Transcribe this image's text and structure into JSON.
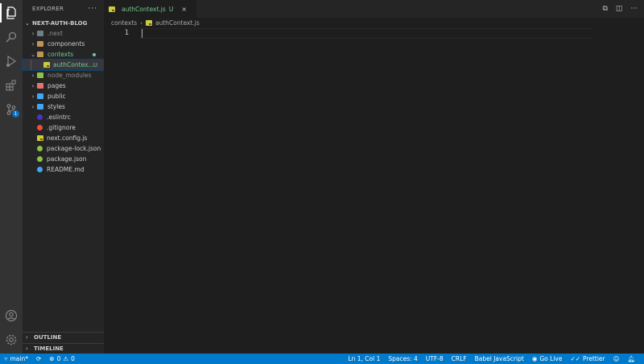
{
  "explorer": {
    "title": "EXPLORER",
    "more": "···",
    "project": "NEXT-AUTH-BLOG",
    "tree": [
      {
        "label": ".next",
        "type": "folder",
        "color": "#6d8086",
        "dim": true
      },
      {
        "label": "components",
        "type": "folder",
        "color": "#c09553"
      },
      {
        "label": "contexts",
        "type": "folder-open",
        "color": "#c09553",
        "green": true
      },
      {
        "label": "authContex...",
        "status": "U",
        "type": "file-js",
        "selected": true
      },
      {
        "label": "node_modules",
        "type": "folder",
        "color": "#8bc34a",
        "dim": true
      },
      {
        "label": "pages",
        "type": "folder",
        "color": "#e57373"
      },
      {
        "label": "public",
        "type": "folder",
        "color": "#42a5f5"
      },
      {
        "label": "styles",
        "type": "folder",
        "color": "#42a5f5"
      },
      {
        "label": ".eslintrc",
        "type": "file",
        "color": "#4b32c3"
      },
      {
        "label": ".gitignore",
        "type": "file",
        "color": "#f14e32"
      },
      {
        "label": "next.config.js",
        "type": "file-js"
      },
      {
        "label": "package-lock.json",
        "type": "file",
        "color": "#8bc34a"
      },
      {
        "label": "package.json",
        "type": "file",
        "color": "#8bc34a"
      },
      {
        "label": "README.md",
        "type": "file",
        "color": "#42a5f5"
      }
    ],
    "outline": "OUTLINE",
    "timeline": "TIMELINE"
  },
  "activity_bar": {
    "source_control_badge": "1"
  },
  "tab": {
    "label": "authContext.js",
    "status": "U",
    "close": "×"
  },
  "breadcrumbs": {
    "folder": "contexts",
    "file": "authContext.js"
  },
  "editor": {
    "line_number": "1"
  },
  "statusbar": {
    "branch": "main*",
    "errors": "0",
    "warnings": "0",
    "position": "Ln 1, Col 1",
    "spaces": "Spaces: 4",
    "encoding": "UTF-8",
    "eol": "CRLF",
    "language": "Babel JavaScript",
    "golive": "Go Live",
    "prettier": "Prettier"
  },
  "colors": {
    "accent": "#007acc",
    "untracked": "#73c991"
  }
}
